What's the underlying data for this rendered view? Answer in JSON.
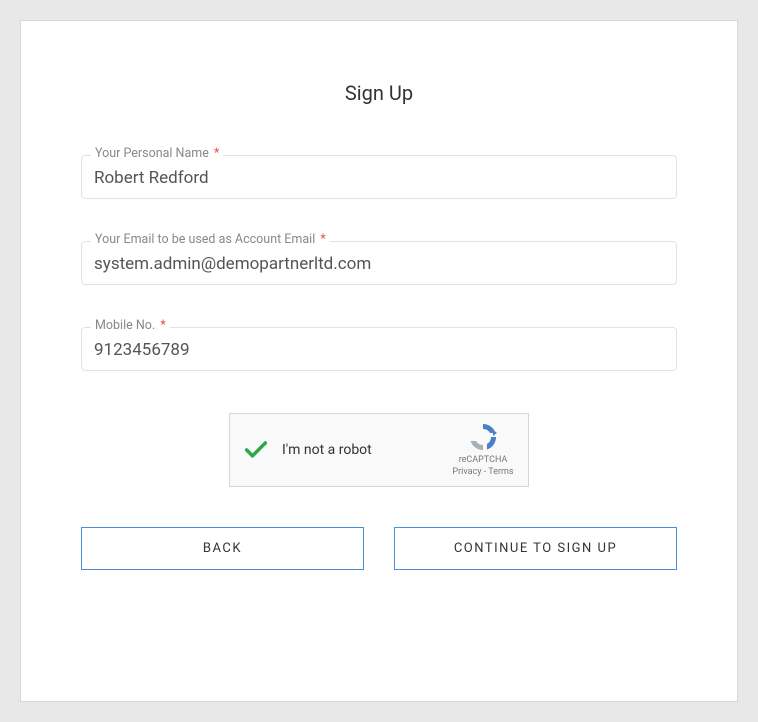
{
  "title": "Sign Up",
  "fields": {
    "name": {
      "label": "Your Personal Name",
      "value": "Robert Redford",
      "required": "*"
    },
    "email": {
      "label": "Your Email to be used as Account Email",
      "value": "system.admin@demopartnerltd.com",
      "required": "*"
    },
    "mobile": {
      "label": "Mobile No.",
      "value": "9123456789",
      "required": "*"
    }
  },
  "captcha": {
    "text": "I'm not a robot",
    "brand": "reCAPTCHA",
    "privacy": "Privacy",
    "terms": "Terms",
    "separator": " - "
  },
  "buttons": {
    "back": "BACK",
    "continue": "CONTINUE TO SIGN UP"
  }
}
